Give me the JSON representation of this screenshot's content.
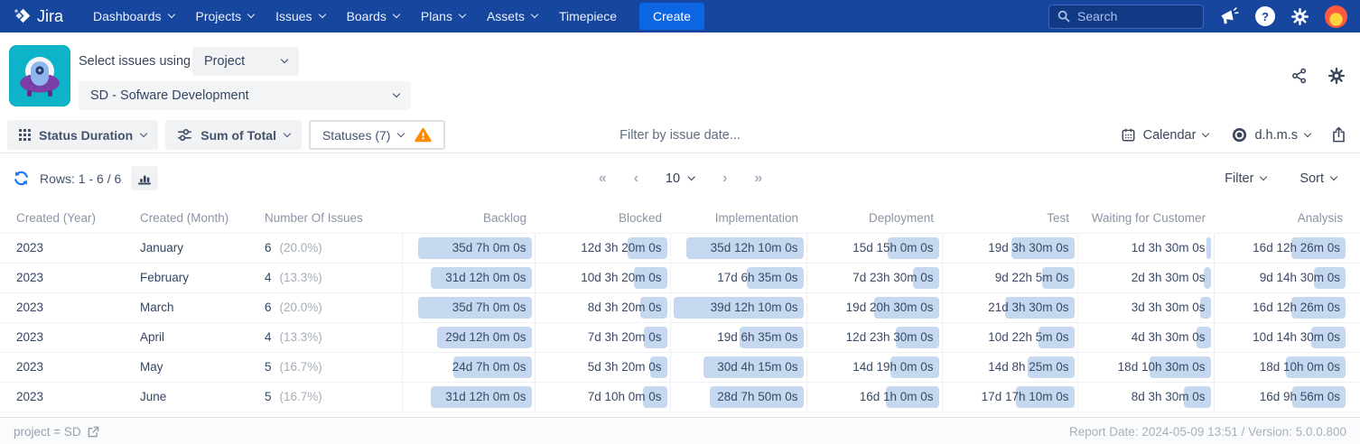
{
  "nav": {
    "brand": "Jira",
    "items": [
      {
        "label": "Dashboards",
        "caret": true
      },
      {
        "label": "Projects",
        "caret": true
      },
      {
        "label": "Issues",
        "caret": true
      },
      {
        "label": "Boards",
        "caret": true
      },
      {
        "label": "Plans",
        "caret": true
      },
      {
        "label": "Assets",
        "caret": true
      },
      {
        "label": "Timepiece",
        "caret": false
      }
    ],
    "create_label": "Create",
    "search_placeholder": "Search"
  },
  "header": {
    "select_label": "Select issues using",
    "mode_value": "Project",
    "project_value": "SD - Sofware Development"
  },
  "toolbar": {
    "report_type": "Status Duration",
    "aggregation": "Sum of Total",
    "statuses": "Statuses (7)",
    "date_filter_placeholder": "Filter by issue date...",
    "calendar_label": "Calendar",
    "time_format_label": "d.h.m.s"
  },
  "pagination": {
    "rows_label": "Rows: 1 - 6 / 6",
    "first": "«",
    "prev": "‹",
    "page_size": "10",
    "next": "›",
    "last": "»",
    "filter_label": "Filter",
    "sort_label": "Sort"
  },
  "table": {
    "columns": [
      "Created (Year)",
      "Created (Month)",
      "Number Of Issues",
      "Backlog",
      "Blocked",
      "Implementation",
      "Deployment",
      "Test",
      "Waiting for Customer",
      "Analysis"
    ],
    "rows": [
      {
        "year": "2023",
        "month": "January",
        "issues": "6",
        "pct": "(20.0%)",
        "durations": [
          "35d 7h 0m 0s",
          "12d 3h 20m 0s",
          "35d 12h 10m 0s",
          "15d 15h 0m 0s",
          "19d 3h 30m 0s",
          "1d 3h 30m 0s",
          "16d 12h 26m 0s"
        ]
      },
      {
        "year": "2023",
        "month": "February",
        "issues": "4",
        "pct": "(13.3%)",
        "durations": [
          "31d 12h 0m 0s",
          "10d 3h 20m 0s",
          "17d 6h 35m 0s",
          "7d 23h 30m 0s",
          "9d 22h 5m 0s",
          "2d 3h 30m 0s",
          "9d 14h 30m 0s"
        ]
      },
      {
        "year": "2023",
        "month": "March",
        "issues": "6",
        "pct": "(20.0%)",
        "durations": [
          "35d 7h 0m 0s",
          "8d 3h 20m 0s",
          "39d 12h 10m 0s",
          "19d 20h 30m 0s",
          "21d 3h 30m 0s",
          "3d 3h 30m 0s",
          "16d 12h 26m 0s"
        ]
      },
      {
        "year": "2023",
        "month": "April",
        "issues": "4",
        "pct": "(13.3%)",
        "durations": [
          "29d 12h 0m 0s",
          "7d 3h 20m 0s",
          "19d 6h 35m 0s",
          "12d 23h 30m 0s",
          "10d 22h 5m 0s",
          "4d 3h 30m 0s",
          "10d 14h 30m 0s"
        ]
      },
      {
        "year": "2023",
        "month": "May",
        "issues": "5",
        "pct": "(16.7%)",
        "durations": [
          "24d 7h 0m 0s",
          "5d 3h 20m 0s",
          "30d 4h 15m 0s",
          "14d 19h 0m 0s",
          "14d 8h 25m 0s",
          "18d 10h 30m 0s",
          "18d 10h 0m 0s"
        ]
      },
      {
        "year": "2023",
        "month": "June",
        "issues": "5",
        "pct": "(16.7%)",
        "durations": [
          "31d 12h 0m 0s",
          "7d 10h 0m 0s",
          "28d 7h 50m 0s",
          "16d 1h 0m 0s",
          "17d 17h 10m 0s",
          "8d 3h 30m 0s",
          "16d 9h 56m 0s"
        ]
      }
    ]
  },
  "footer": {
    "query": "project = SD",
    "report_info": "Report Date: 2024-05-09 13:51 / Version: 5.0.0.800"
  },
  "colors": {
    "navbar_bg": "#17469F",
    "create_btn": "#0C66E4",
    "accent_blue": "#1D7AFC",
    "bar_fill": "#C5D8F0",
    "warning": "#FF8B00",
    "avatar_bg": "#FF5A3C"
  }
}
